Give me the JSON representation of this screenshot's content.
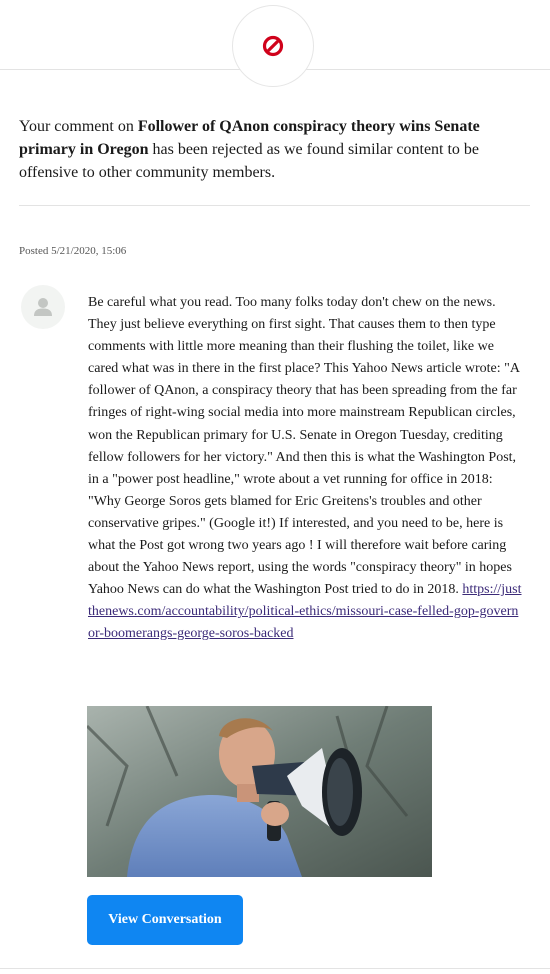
{
  "status": {
    "icon": "prohibited-icon",
    "color": "#d0021b"
  },
  "message": {
    "prefix": "Your comment on ",
    "article_title": "Follower of QAnon conspiracy theory wins Senate primary in Oregon",
    "suffix": " has been rejected as we found similar content to be offensive to other community members."
  },
  "posted": {
    "text": "Posted 5/21/2020, 15:06"
  },
  "comment": {
    "avatar_icon": "user-avatar-icon",
    "body": "Be careful what you read. Too many folks today don't chew on the news. They just believe everything on first sight. That causes them to then type comments with little more meaning than their flushing the toilet, like we cared what was in there in the first place? This Yahoo News article wrote: \"A follower of QAnon, a conspiracy theory that has been spreading from the far fringes of right-wing social media into more mainstream Republican circles, won the Republican primary for U.S. Senate in Oregon Tuesday, crediting fellow followers for her victory.\" And then this is what the Washington Post, in a \"power post headline,\" wrote about a vet running for office in 2018: \"Why George Soros gets blamed for Eric Greitens's troubles and other conservative gripes.\" (Google it!) If interested, and you need to be, here is what the Post got wrong two years ago ! I will therefore wait before caring about the Yahoo News report, using the words \"conspiracy theory\" in hopes Yahoo News can do what the Washington Post tried to do in 2018.",
    "link": "https://justthenews.com/accountability/political-ethics/missouri-case-felled-gop-governor-boomerangs-george-soros-backed"
  },
  "photo": {
    "subject": "man-with-megaphone-photo"
  },
  "actions": {
    "view_conversation_label": "View Conversation",
    "button_color": "#0f86f2"
  }
}
